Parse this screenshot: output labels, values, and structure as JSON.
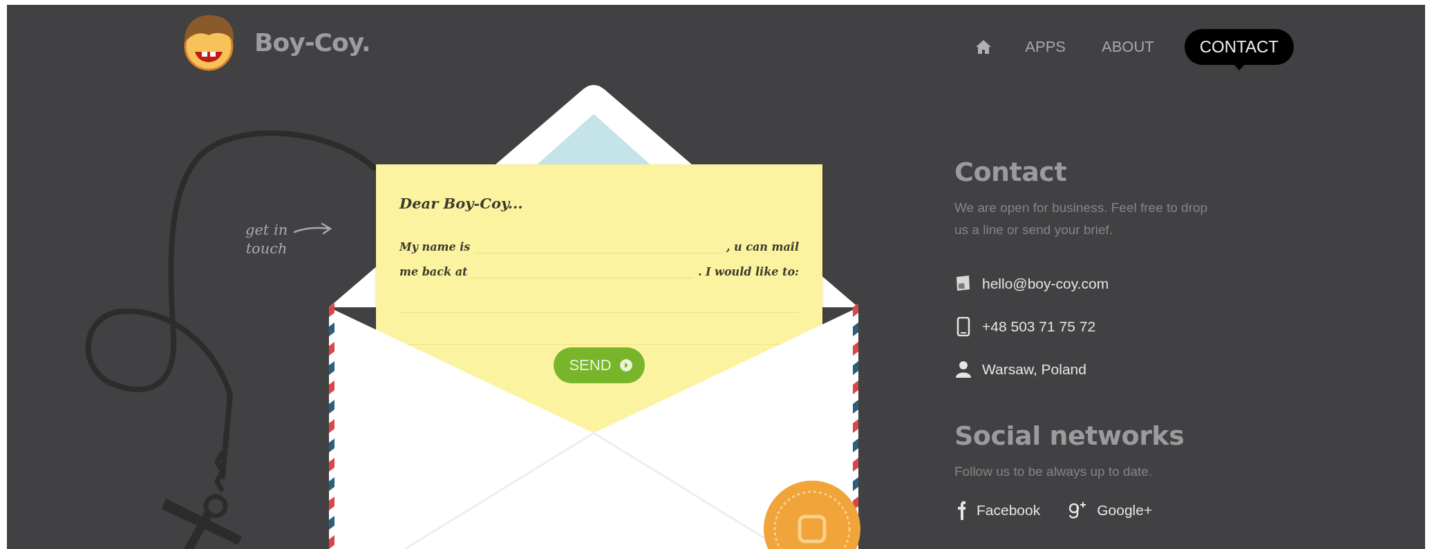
{
  "logo": {
    "text": "Boy-Coy."
  },
  "nav": [
    {
      "kind": "home",
      "selected": false
    },
    {
      "kind": "text",
      "label": "APPS",
      "selected": false
    },
    {
      "kind": "text",
      "label": "ABOUT",
      "selected": false
    },
    {
      "kind": "text",
      "label": "CONTACT",
      "selected": true
    }
  ],
  "note": {
    "lines": [
      "get in",
      "touch"
    ]
  },
  "letter": {
    "greeting": "Dear Boy-Coy...",
    "rows": [
      {
        "before": "My name is",
        "after": ", u can mail"
      },
      {
        "before": "me back at",
        "after": ". I would like to:"
      }
    ],
    "send_button": "SEND"
  },
  "contact": {
    "title": "Contact",
    "text": "We are open for business. Feel free to drop us a line or send your brief.",
    "items": [
      {
        "kind": "email",
        "text": "hello@boy-coy.com"
      },
      {
        "kind": "phone",
        "text": "+48 503 71 75 72"
      },
      {
        "kind": "location",
        "text": "Warsaw, Poland"
      }
    ]
  },
  "social": {
    "title": "Social networks",
    "text": "Follow us to be always up to date.",
    "links": [
      {
        "kind": "facebook",
        "label": "Facebook"
      },
      {
        "kind": "googleplus",
        "label": "Google+"
      }
    ]
  }
}
